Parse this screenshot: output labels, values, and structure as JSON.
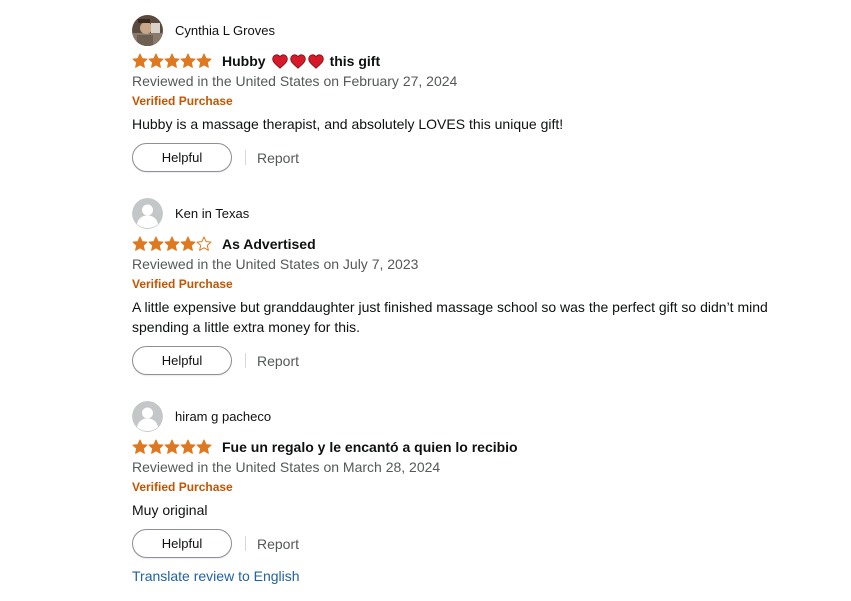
{
  "colors": {
    "star": "#de7921",
    "verified": "#c45500",
    "link": "#2162a1",
    "heart": "#d61a2a",
    "secondary_text": "#565959"
  },
  "reviews": [
    {
      "profile_name": "Cynthia L Groves",
      "avatar": "photo-avatar",
      "rating": 5,
      "title_before": "Hubby",
      "title_icons": [
        "heart-icon",
        "heart-icon",
        "heart-icon"
      ],
      "title_after": "this gift",
      "date": "Reviewed in the United States on February 27, 2024",
      "verified": "Verified Purchase",
      "body": "Hubby is a massage therapist, and absolutely LOVES this unique gift!",
      "helpful_label": "Helpful",
      "report_label": "Report"
    },
    {
      "profile_name": "Ken in Texas",
      "avatar": "default-avatar",
      "rating": 4,
      "title": "As Advertised",
      "date": "Reviewed in the United States on July 7, 2023",
      "verified": "Verified Purchase",
      "body": "A little expensive but granddaughter just finished massage school so was the perfect gift so didn’t mind spending a little extra money for this.",
      "helpful_label": "Helpful",
      "report_label": "Report"
    },
    {
      "profile_name": "hiram g pacheco",
      "avatar": "default-avatar",
      "rating": 5,
      "title": "Fue un regalo y le encantó a quien lo recibio",
      "date": "Reviewed in the United States on March 28, 2024",
      "verified": "Verified Purchase",
      "body": "Muy original",
      "helpful_label": "Helpful",
      "report_label": "Report",
      "translate_label": "Translate review to English"
    }
  ]
}
